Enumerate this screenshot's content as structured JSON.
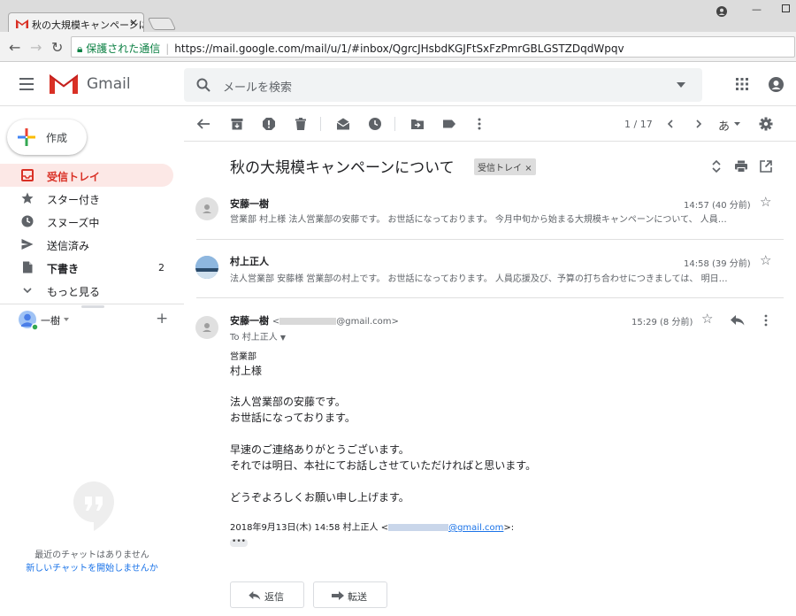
{
  "browser": {
    "tab_title": "秋の大規模キャンペーンについて",
    "secure_label": "保護された通信",
    "url": "https://mail.google.com/mail/u/1/#inbox/QgrcJHsbdKGJFtSxFzPmrGBLGSTZDqdWpqv"
  },
  "header": {
    "app_name": "Gmail",
    "search_placeholder": "メールを検索"
  },
  "sidebar": {
    "compose_label": "作成",
    "items": [
      {
        "label": "受信トレイ",
        "count": "",
        "icon": "inbox-icon",
        "active": true
      },
      {
        "label": "スター付き",
        "count": "",
        "icon": "star-icon",
        "active": false
      },
      {
        "label": "スヌーズ中",
        "count": "",
        "icon": "clock-icon",
        "active": false
      },
      {
        "label": "送信済み",
        "count": "",
        "icon": "send-icon",
        "active": false
      },
      {
        "label": "下書き",
        "count": "2",
        "icon": "draft-icon",
        "active": false
      },
      {
        "label": "もっと見る",
        "count": "",
        "icon": "chevron-down-icon",
        "active": false
      }
    ],
    "account_name": "一樹",
    "chat_empty": "最近のチャットはありません",
    "chat_start_link": "新しいチャットを開始しませんか"
  },
  "toolbar": {
    "page_count": "1 / 17",
    "input_tool": "あ"
  },
  "thread": {
    "subject": "秋の大規模キャンペーンについて",
    "label": "受信トレイ",
    "messages": [
      {
        "sender": "安藤一樹",
        "time": "14:57 (40 分前)",
        "snippet": "営業部 村上様 法人営業部の安藤です。 お世話になっております。 今月中旬から始まる大規模キャンペーンについて、 人員…"
      },
      {
        "sender": "村上正人",
        "time": "14:58 (39 分前)",
        "snippet": "法人営業部 安藤様 営業部の村上です。 お世話になっております。 人員応援及び、予算の打ち合わせにつきましては、 明日…"
      }
    ],
    "open": {
      "sender": "安藤一樹",
      "email_suffix": "@gmail.com>",
      "time": "15:29 (8 分前)",
      "to": "To 村上正人",
      "body": [
        "営業部",
        "村上様",
        "法人営業部の安藤です。",
        "お世話になっております。",
        "早速のご連絡ありがとうございます。",
        "それでは明日、本社にてお話しさせていただければと思います。",
        "どうぞよろしくお願い申し上げます。"
      ],
      "quote_prefix": "2018年9月13日(木) 14:58 村上正人 <",
      "quote_email": "@gmail.com",
      "quote_suffix": ">:",
      "ellipsis": "•••"
    },
    "reply_label": "返信",
    "forward_label": "転送"
  }
}
